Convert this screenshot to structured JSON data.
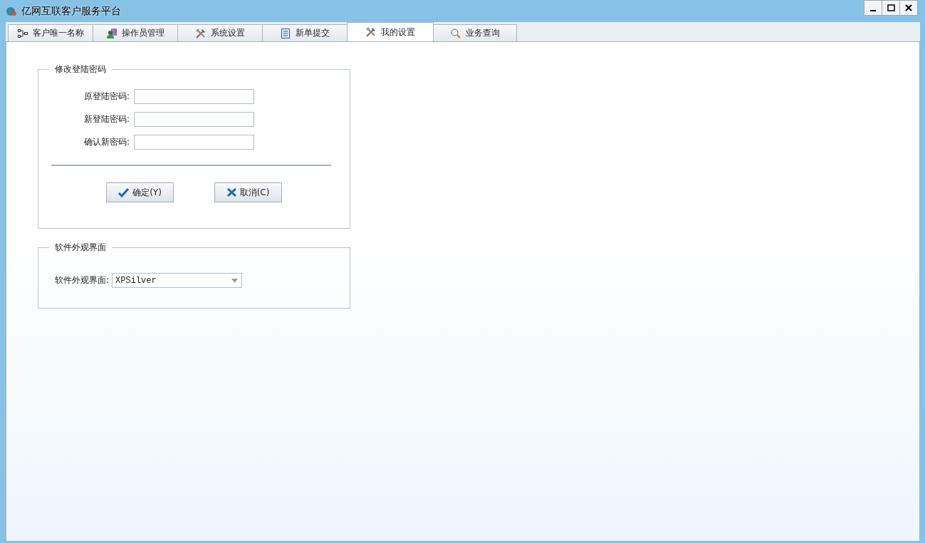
{
  "window": {
    "title": "亿网互联客户服务平台"
  },
  "tabs": [
    {
      "label": "客户唯一名称",
      "selected": false
    },
    {
      "label": "操作员管理",
      "selected": false
    },
    {
      "label": "系统设置",
      "selected": false
    },
    {
      "label": "新单提交",
      "selected": false
    },
    {
      "label": "我的设置",
      "selected": true
    },
    {
      "label": "业务查询",
      "selected": false
    }
  ],
  "password_group": {
    "title": "修改登陆密码",
    "fields": [
      {
        "label": "原登陆密码:"
      },
      {
        "label": "新登陆密码:"
      },
      {
        "label": "确认新密码:"
      }
    ],
    "buttons": [
      {
        "label": "确定(Y)",
        "kind": "ok"
      },
      {
        "label": "取消(C)",
        "kind": "cancel"
      }
    ]
  },
  "appearance_group": {
    "title": "软件外观界面",
    "label": "软件外观界面:",
    "value": "XPSilver"
  }
}
